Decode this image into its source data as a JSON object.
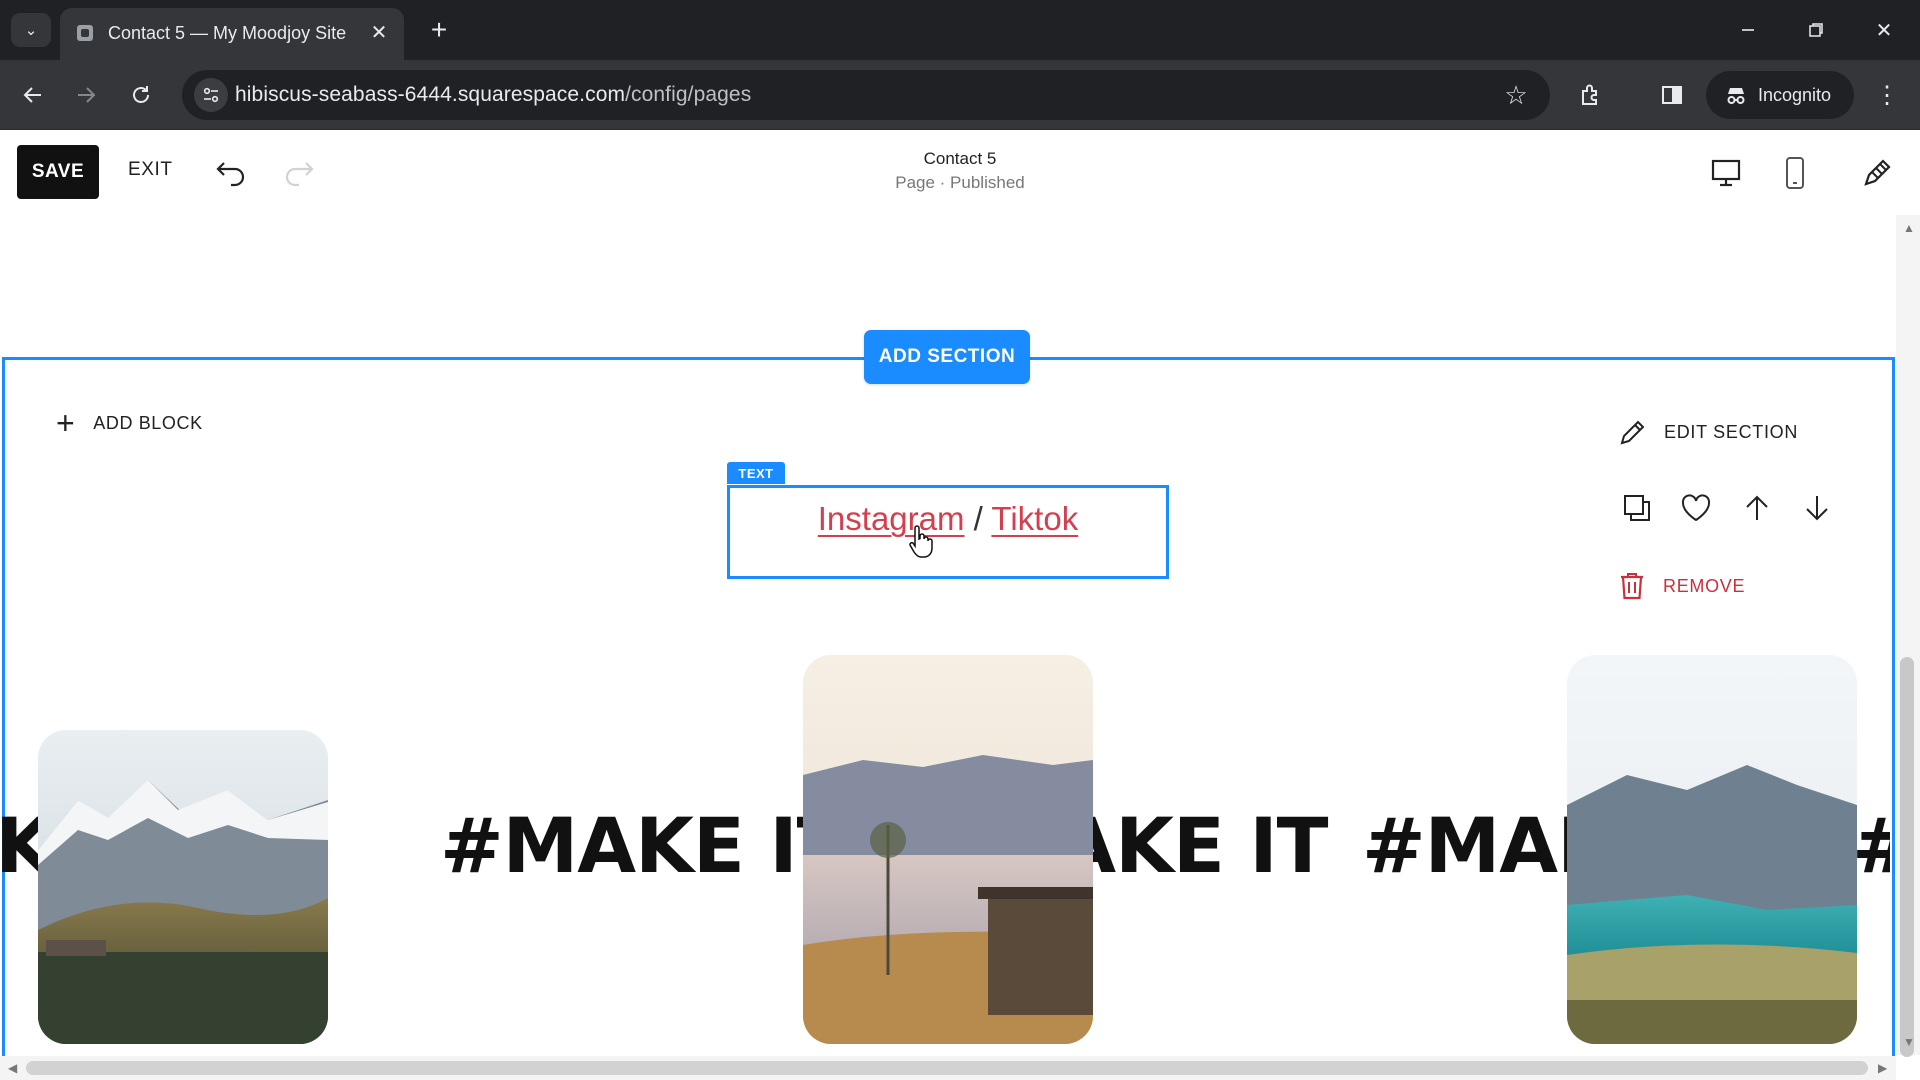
{
  "browser": {
    "tab_title": "Contact 5 — My Moodjoy Site",
    "url_host": "hibiscus-seabass-6444.squarespace.com",
    "url_path": "/config/pages",
    "profile_label": "Incognito"
  },
  "editor": {
    "save_label": "SAVE",
    "exit_label": "EXIT",
    "page_title": "Contact 5",
    "page_status": "Page · Published"
  },
  "canvas": {
    "add_section_label": "ADD SECTION",
    "add_block_label": "ADD BLOCK",
    "text_block_tag": "TEXT",
    "social_links": {
      "instagram": "Instagram",
      "separator": " / ",
      "tiktok": "Tiktok"
    },
    "section_actions": {
      "edit_label": "EDIT SECTION",
      "remove_label": "REMOVE"
    },
    "marquee_text": "#MAKE IT"
  },
  "colors": {
    "accent": "#1a8cff",
    "link": "#d43f4f",
    "remove": "#c8303e"
  }
}
